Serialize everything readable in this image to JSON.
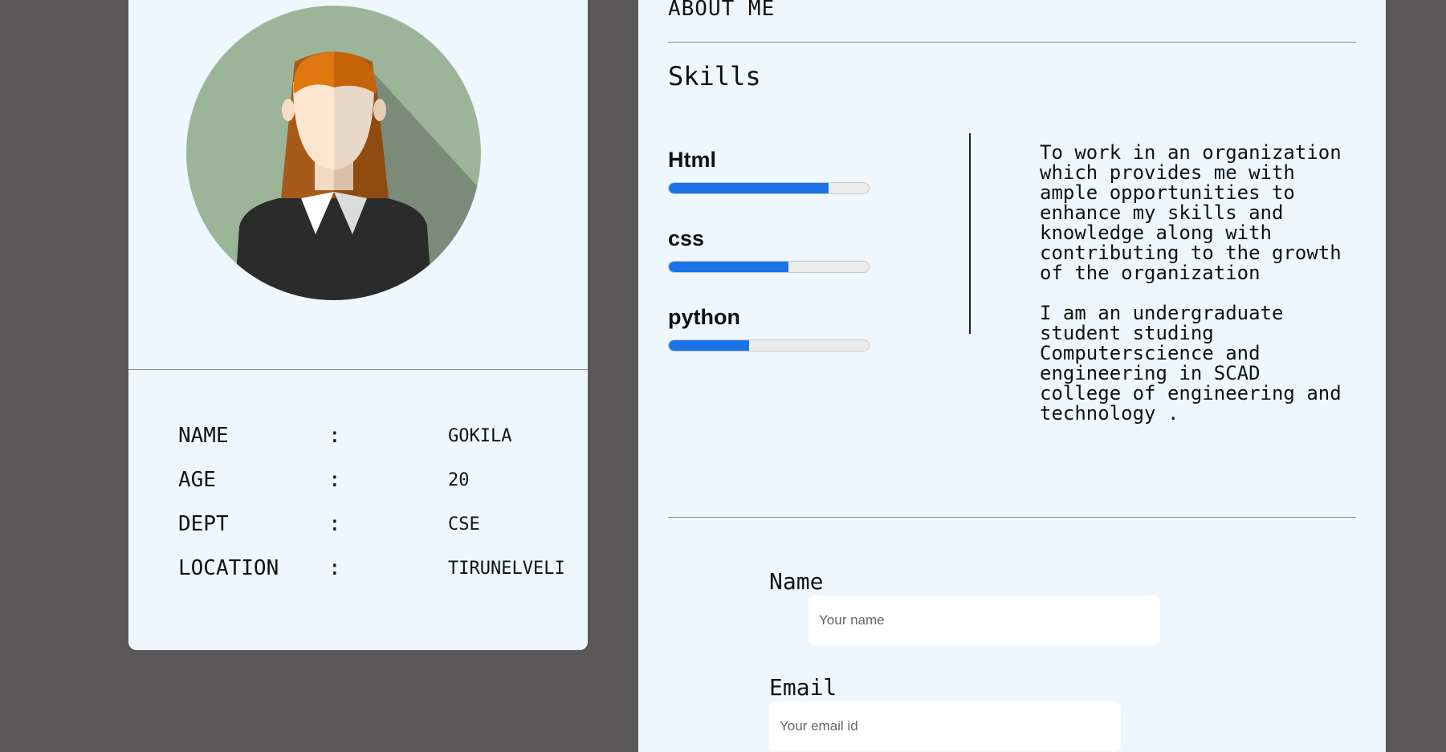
{
  "profile": {
    "fields": [
      {
        "key": "NAME",
        "value": "GOKILA"
      },
      {
        "key": "AGE",
        "value": "20"
      },
      {
        "key": "DEPT",
        "value": "CSE"
      },
      {
        "key": "LOCATION",
        "value": "TIRUNELVELI"
      }
    ],
    "separator": ":"
  },
  "about": {
    "title": "ABOUT ME",
    "skills_title": "Skills",
    "skills": [
      {
        "name": "Html",
        "level": 0.8
      },
      {
        "name": "css",
        "level": 0.6
      },
      {
        "name": "python",
        "level": 0.4
      }
    ],
    "objective": "To work in an organization\nwhich provides me with\nample opportunities to\nenhance my skills and\nknowledge along with\ncontributing to the growth\nof the organization\n\nI am an undergraduate\nstudent studing\nComputerscience and\nengineering in SCAD\ncollege of engineering and\ntechnology ."
  },
  "contact_form": {
    "name_label": "Name",
    "name_placeholder": "Your name",
    "email_label": "Email",
    "email_placeholder": "Your email id"
  },
  "colors": {
    "page_bg": "#5a5858",
    "card_bg": "#eef7fe",
    "progress_fill": "#1a73e8",
    "avatar_circle": "#9cb598"
  }
}
